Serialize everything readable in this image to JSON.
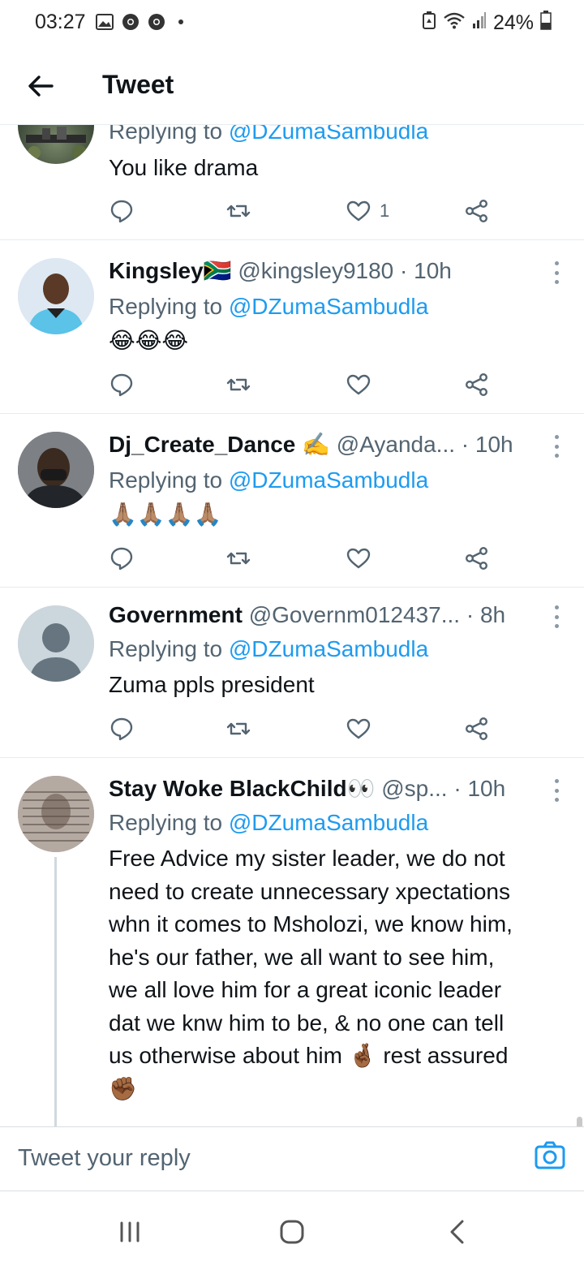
{
  "status": {
    "time": "03:27",
    "battery": "24%"
  },
  "header": {
    "title": "Tweet"
  },
  "tweets": [
    {
      "reply_label": "Replying to ",
      "reply_to": "@DZumaSambudla",
      "text": "You like drama",
      "like_count": "1"
    },
    {
      "name": "Kingsley",
      "name_emoji": "🇿🇦",
      "handle": "@kingsley9180",
      "time": "· 10h",
      "reply_label": "Replying to ",
      "reply_to": "@DZumaSambudla",
      "text": "😂😂😂"
    },
    {
      "name": "Dj_Create_Dance",
      "name_emoji": "✍️",
      "handle": "@Ayanda...",
      "time": "· 10h",
      "reply_label": "Replying to ",
      "reply_to": "@DZumaSambudla",
      "text": "🙏🏽🙏🏽🙏🏽🙏🏽"
    },
    {
      "name": "Government",
      "handle": "@Governm012437...",
      "time": "· 8h",
      "reply_label": "Replying to ",
      "reply_to": "@DZumaSambudla",
      "text": "Zuma ppls president"
    },
    {
      "name": "Stay Woke BlackChild",
      "name_emoji": "👀",
      "handle": "@sp...",
      "time": "· 10h",
      "reply_label": "Replying to ",
      "reply_to": "@DZumaSambudla",
      "text_lines": [
        "Free Advice my sister leader, we do not",
        "need to create unnecessary xpectations",
        "whn it comes to Msholozi, we know him,",
        "he's our father, we all want to see him,",
        "we all love him for a great iconic leader",
        "dat we knw him to be, & no one can tell",
        "us otherwise about him 🤞🏾 rest assured",
        "✊🏾"
      ]
    }
  ],
  "composer": {
    "placeholder": "Tweet your reply"
  },
  "colors": {
    "link": "#1d9bf0",
    "secondary_text": "#536471",
    "divider": "#e6ecf0"
  }
}
